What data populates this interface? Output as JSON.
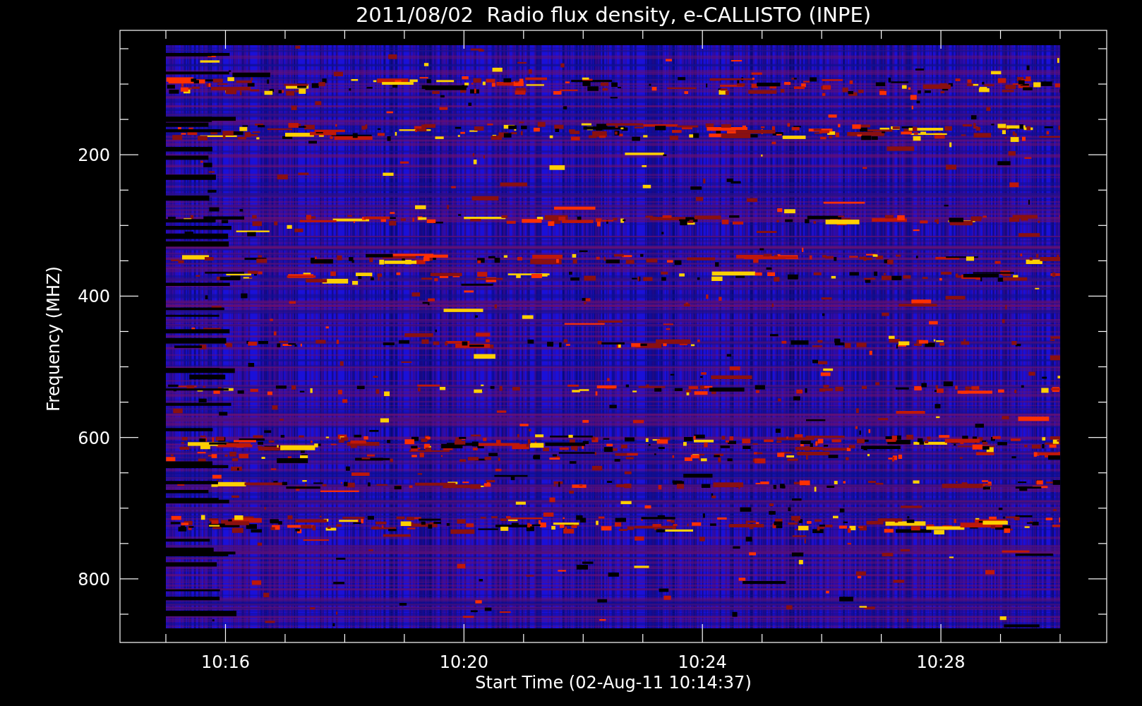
{
  "title": "2011/08/02  Radio flux density, e-CALLISTO (INPE)",
  "xlabel": "Start Time (02-Aug-11 10:14:37)",
  "ylabel": "Frequency (MHZ)",
  "x_tick_labels": [
    "10:16",
    "10:20",
    "10:24",
    "10:28"
  ],
  "y_tick_labels": [
    "200",
    "400",
    "600",
    "800"
  ]
}
